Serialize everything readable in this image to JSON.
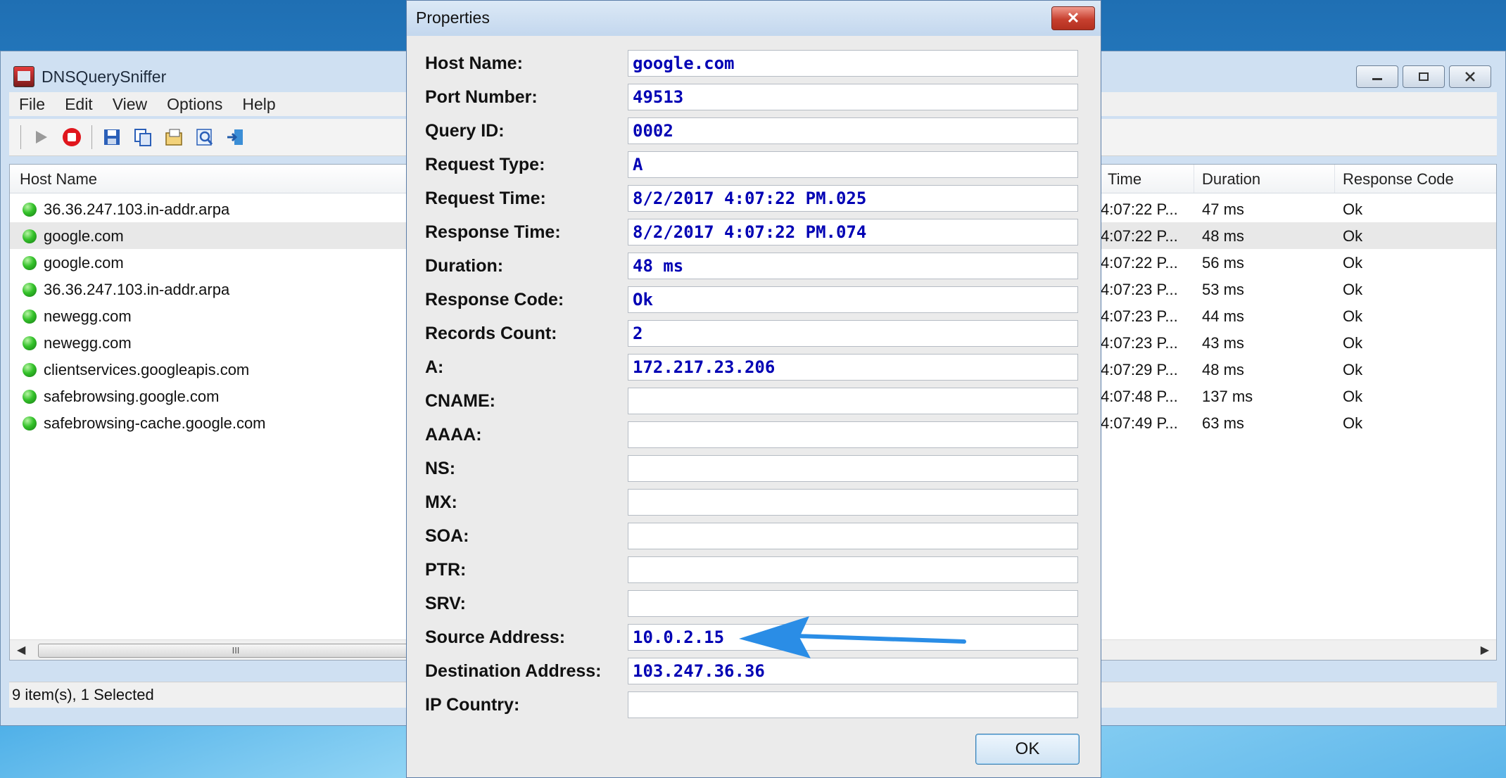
{
  "main_window": {
    "title": "DNSQuerySniffer",
    "menu": [
      "File",
      "Edit",
      "View",
      "Options",
      "Help"
    ],
    "columns": [
      "Host Name",
      "Time",
      "Duration",
      "Response Code"
    ],
    "rows": [
      {
        "host": "36.36.247.103.in-addr.arpa",
        "time": "4:07:22 P...",
        "duration": "47 ms",
        "code": "Ok"
      },
      {
        "host": "google.com",
        "time": "4:07:22 P...",
        "duration": "48 ms",
        "code": "Ok"
      },
      {
        "host": "google.com",
        "time": "4:07:22 P...",
        "duration": "56 ms",
        "code": "Ok"
      },
      {
        "host": "36.36.247.103.in-addr.arpa",
        "time": "4:07:23 P...",
        "duration": "53 ms",
        "code": "Ok"
      },
      {
        "host": "newegg.com",
        "time": "4:07:23 P...",
        "duration": "44 ms",
        "code": "Ok"
      },
      {
        "host": "newegg.com",
        "time": "4:07:23 P...",
        "duration": "43 ms",
        "code": "Ok"
      },
      {
        "host": "clientservices.googleapis.com",
        "time": "4:07:29 P...",
        "duration": "48 ms",
        "code": "Ok"
      },
      {
        "host": "safebrowsing.google.com",
        "time": "4:07:48 P...",
        "duration": "137 ms",
        "code": "Ok"
      },
      {
        "host": "safebrowsing-cache.google.com",
        "time": "4:07:49 P...",
        "duration": "63 ms",
        "code": "Ok"
      }
    ],
    "status": "9 item(s), 1 Selected",
    "scroll_thumb_glyph": "III"
  },
  "dialog": {
    "title": "Properties",
    "ok_label": "OK",
    "close_glyph": "✕",
    "fields": [
      {
        "label": "Host Name:",
        "value": "google.com"
      },
      {
        "label": "Port Number:",
        "value": "49513"
      },
      {
        "label": "Query ID:",
        "value": "0002"
      },
      {
        "label": "Request Type:",
        "value": "A"
      },
      {
        "label": "Request Time:",
        "value": "8/2/2017 4:07:22 PM.025"
      },
      {
        "label": "Response Time:",
        "value": "8/2/2017 4:07:22 PM.074"
      },
      {
        "label": "Duration:",
        "value": "48 ms"
      },
      {
        "label": "Response Code:",
        "value": "Ok"
      },
      {
        "label": "Records Count:",
        "value": "2"
      },
      {
        "label": "A:",
        "value": "172.217.23.206"
      },
      {
        "label": "CNAME:",
        "value": ""
      },
      {
        "label": "AAAA:",
        "value": ""
      },
      {
        "label": "NS:",
        "value": ""
      },
      {
        "label": "MX:",
        "value": ""
      },
      {
        "label": "SOA:",
        "value": ""
      },
      {
        "label": "PTR:",
        "value": ""
      },
      {
        "label": "SRV:",
        "value": ""
      },
      {
        "label": "Source Address:",
        "value": "10.0.2.15"
      },
      {
        "label": "Destination Address:",
        "value": "103.247.36.36"
      },
      {
        "label": "IP Country:",
        "value": ""
      }
    ]
  },
  "annotation": {
    "icon": "arrow-left-icon",
    "color": "#2a8de6"
  },
  "colors": {
    "field_value": "#0000b4",
    "close_button": "#c7402f",
    "status_dot": "#34c22a"
  }
}
